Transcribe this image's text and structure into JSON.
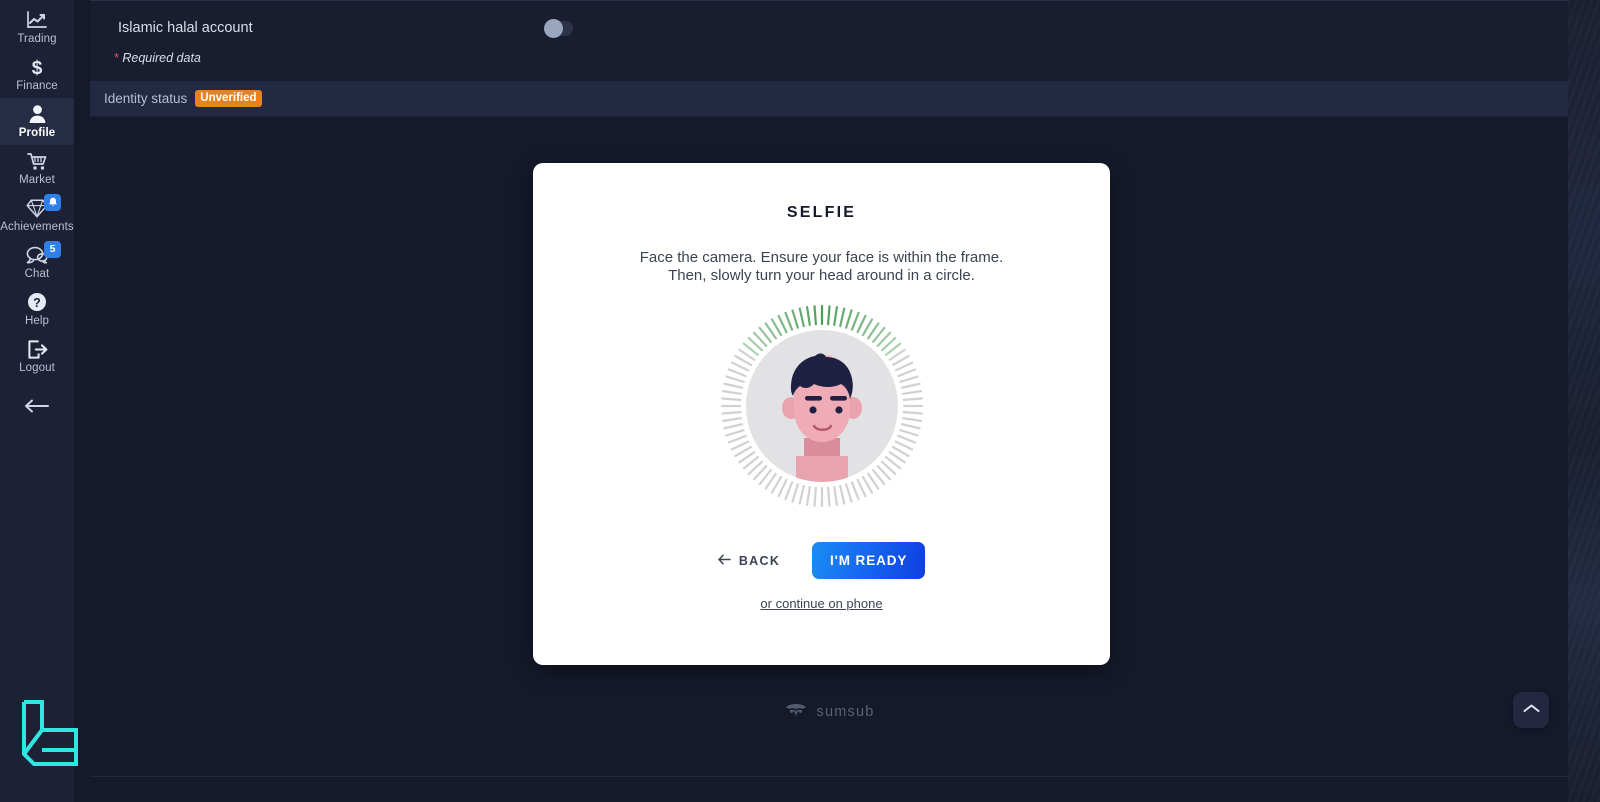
{
  "sidebar": {
    "items": [
      {
        "label": "Trading",
        "icon": "chart-line-icon",
        "active": false,
        "badge": null
      },
      {
        "label": "Finance",
        "icon": "dollar-icon",
        "active": false,
        "badge": null
      },
      {
        "label": "Profile",
        "icon": "user-icon",
        "active": true,
        "badge": null
      },
      {
        "label": "Market",
        "icon": "cart-icon",
        "active": false,
        "badge": null
      },
      {
        "label": "Achievements",
        "icon": "diamond-icon",
        "active": false,
        "badge": "bell"
      },
      {
        "label": "Chat",
        "icon": "chat-icon",
        "active": false,
        "badge": "5"
      },
      {
        "label": "Help",
        "icon": "question-icon",
        "active": false,
        "badge": null
      },
      {
        "label": "Logout",
        "icon": "logout-icon",
        "active": false,
        "badge": null
      }
    ],
    "collapse_icon": "arrow-left-icon",
    "brand_logo": "le-monogram-logo",
    "accent_color": "#2f7fea",
    "background_color": "#1c2136"
  },
  "settings": {
    "halal_label": "Islamic halal account",
    "halal_toggle_state": "off",
    "required_note": "Required data",
    "required_star": "*"
  },
  "identity": {
    "label": "Identity status",
    "status": "Unverified",
    "status_color": "#e8821e"
  },
  "kyc": {
    "title": "SELFIE",
    "description_line1": "Face the camera. Ensure your face is within the frame.",
    "description_line2": "Then, slowly turn your head around in a circle.",
    "back_label": "BACK",
    "back_icon": "arrow-left-icon",
    "ready_label": "I'M READY",
    "phone_link": "or continue on phone",
    "avatar_icon": "selfie-avatar-illustration",
    "ray_active_color": "#4e9e5a",
    "ray_inactive_color": "#c9cacc",
    "button_color": "#1565f0"
  },
  "footer": {
    "provider": "sumsub",
    "provider_icon": "sumsub-logo"
  },
  "scroll_top": {
    "icon": "chevron-up-icon"
  }
}
